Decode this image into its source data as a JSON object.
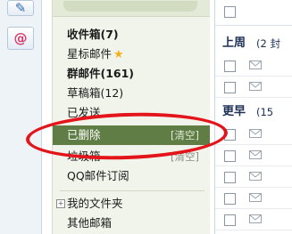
{
  "apps": [
    {
      "icon": "compose-icon",
      "glyph": "✎"
    },
    {
      "icon": "contacts-at-icon",
      "glyph": "@"
    }
  ],
  "folders": {
    "inbox": "收件箱(7)",
    "starred": "星标邮件",
    "group_mail": "群邮件(161)",
    "drafts": "草稿箱(12)",
    "sent": "已发送",
    "deleted": "已删除",
    "deleted_clear": "[清空]",
    "spam": "垃圾箱",
    "spam_clear": "[清空]",
    "subscriptions": "QQ邮件订阅",
    "my_folders": "我的文件夹",
    "other_mailboxes": "其他邮箱"
  },
  "mail_list": {
    "group_last_week": {
      "title": "上周",
      "count": "(2 封"
    },
    "group_earlier": {
      "title": "更早",
      "count": "(15"
    }
  },
  "colors": {
    "highlight": "#e4141b",
    "selected_bg": "#5f7d45"
  }
}
